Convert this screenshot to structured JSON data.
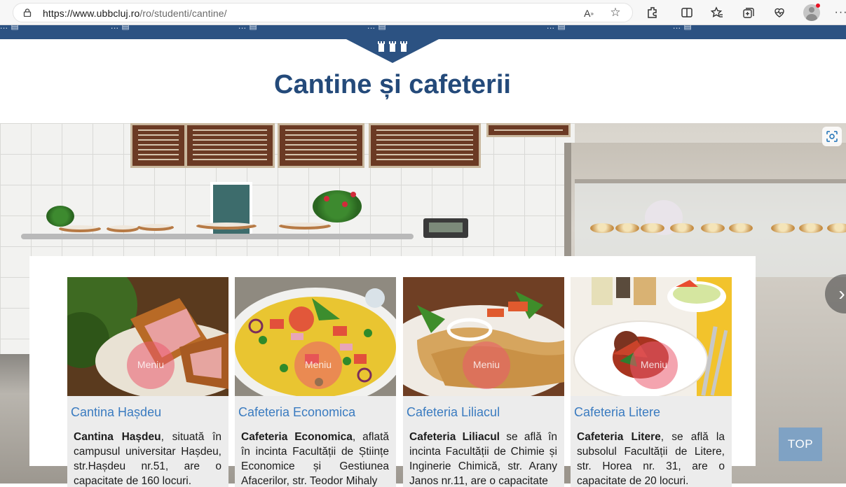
{
  "browser": {
    "url_host": "https://www.ubbcluj.ro",
    "url_path": "/ro/studenti/cantine/",
    "icons": [
      "lock-icon",
      "read-aloud-icon",
      "favorite-star-icon",
      "extensions-icon",
      "split-screen-icon",
      "favorites-icon",
      "collections-icon",
      "performance-icon",
      "profile-avatar",
      "more-icon"
    ]
  },
  "site_nav": {
    "items": [
      "... ▤",
      "... ▤",
      "... ▤",
      "... ▤",
      "... ▤",
      "... ▤"
    ]
  },
  "page": {
    "title": "Cantine și cafeterii"
  },
  "hero": {
    "expand_icon": "visual-search-icon",
    "next_icon": "chevron-right-icon"
  },
  "cards": [
    {
      "title": "Cantina Hașdeu",
      "overlay": "Meniu",
      "bold": "Cantina Hașdeu",
      "text": ", situată în campusul universitar Hașdeu, str.Hașdeu nr.51, are o capacitate de 160 locuri."
    },
    {
      "title": "Cafeteria Economica",
      "overlay": "Meniu",
      "bold": "Cafeteria Economica",
      "text": ", aflată în incinta Facultății de Științe Economice și Gestiunea Afacerilor, str. Teodor Mihaly"
    },
    {
      "title": "Cafeteria Liliacul",
      "overlay": "Meniu",
      "bold": "Cafeteria Liliacul",
      "text": " se află în incinta Facultății de Chimie și Inginerie Chimică, str. Arany Janos nr.11, are o capacitate"
    },
    {
      "title": "Cafeteria Litere",
      "overlay": "Meniu",
      "bold": "Cafeteria Litere",
      "text": ", se află la subsolul Facultății de Litere, str. Horea nr. 31, are o capacitate de 20 locuri."
    }
  ],
  "top_button": "TOP"
}
